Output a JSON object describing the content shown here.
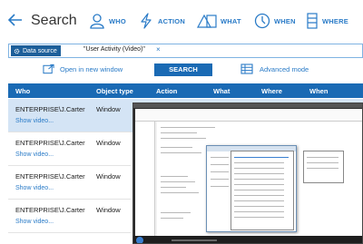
{
  "header": {
    "title": "Search",
    "nav": [
      {
        "key": "who",
        "label": "WHO"
      },
      {
        "key": "action",
        "label": "ACTION"
      },
      {
        "key": "what",
        "label": "WHAT"
      },
      {
        "key": "when",
        "label": "WHEN"
      },
      {
        "key": "where",
        "label": "WHERE"
      }
    ]
  },
  "filter": {
    "chip_label": "Data source",
    "chip_value": "\"User Activity (Video)\"",
    "remove": "×"
  },
  "actions": {
    "open_new": "Open in new window",
    "search": "SEARCH",
    "advanced": "Advanced mode"
  },
  "table": {
    "columns": [
      "Who",
      "Object type",
      "Action",
      "What",
      "Where",
      "When"
    ],
    "rows": [
      {
        "who": "ENTERPRISE\\J.Carter",
        "type": "Window",
        "link": "Show video..."
      },
      {
        "who": "ENTERPRISE\\J.Carter",
        "type": "Window",
        "link": "Show video..."
      },
      {
        "who": "ENTERPRISE\\J.Carter",
        "type": "Window",
        "link": "Show video..."
      },
      {
        "who": "ENTERPRISE\\J.Carter",
        "type": "Window",
        "link": "Show video..."
      }
    ]
  },
  "colors": {
    "accent": "#2a7bc7",
    "header_bg": "#1a6ab4",
    "selected_row": "#d4e4f5"
  }
}
